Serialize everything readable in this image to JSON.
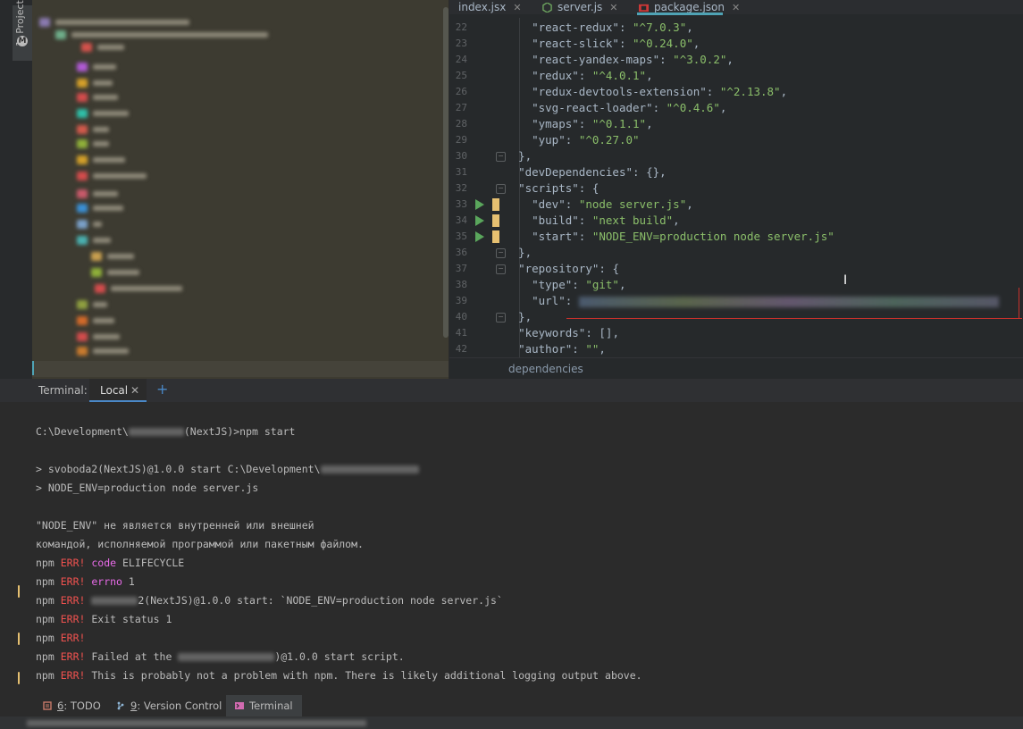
{
  "sidebar": {
    "project_tab_label": "1: Project",
    "project_tab_icon": "M"
  },
  "editor": {
    "tabs": [
      {
        "label": "index.jsx",
        "icon": "react-file-icon"
      },
      {
        "label": "server.js",
        "icon": "nodejs-file-icon"
      },
      {
        "label": "package.json",
        "icon": "npm-file-icon",
        "active": true
      }
    ],
    "lines": [
      {
        "no": "22",
        "key": "\"react-redux\"",
        "val": "\"^7.0.3\"",
        "tail": ","
      },
      {
        "no": "23",
        "key": "\"react-slick\"",
        "val": "\"^0.24.0\"",
        "tail": ","
      },
      {
        "no": "24",
        "key": "\"react-yandex-maps\"",
        "val": "\"^3.0.2\"",
        "tail": ","
      },
      {
        "no": "25",
        "key": "\"redux\"",
        "val": "\"^4.0.1\"",
        "tail": ","
      },
      {
        "no": "26",
        "key": "\"redux-devtools-extension\"",
        "val": "\"^2.13.8\"",
        "tail": ","
      },
      {
        "no": "27",
        "key": "\"svg-react-loader\"",
        "val": "\"^0.4.6\"",
        "tail": ","
      },
      {
        "no": "28",
        "key": "\"ymaps\"",
        "val": "\"^0.1.1\"",
        "tail": ","
      },
      {
        "no": "29",
        "key": "\"yup\"",
        "val": "\"^0.27.0\"",
        "tail": ""
      },
      {
        "no": "30",
        "text": "},"
      },
      {
        "no": "31",
        "key": "\"devDependencies\"",
        "val": "",
        "tail": "{},"
      },
      {
        "no": "32",
        "key": "\"scripts\"",
        "val": "",
        "tail": "{"
      },
      {
        "no": "33",
        "key": "\"dev\"",
        "val": "\"node server.js\"",
        "tail": ","
      },
      {
        "no": "34",
        "key": "\"build\"",
        "val": "\"next build\"",
        "tail": ","
      },
      {
        "no": "35",
        "key": "\"start\"",
        "val": "\"NODE_ENV=production node server.js\"",
        "tail": ""
      },
      {
        "no": "36",
        "text": "},"
      },
      {
        "no": "37",
        "key": "\"repository\"",
        "val": "",
        "tail": "{"
      },
      {
        "no": "38",
        "key": "\"type\"",
        "val": "\"git\"",
        "tail": ","
      },
      {
        "no": "39",
        "key": "\"url\"",
        "val": "",
        "tail": ""
      },
      {
        "no": "40",
        "text": "},"
      },
      {
        "no": "41",
        "key": "\"keywords\"",
        "val": "",
        "tail": "[],"
      },
      {
        "no": "42",
        "key": "\"author\"",
        "val": "\"\"",
        "tail": ","
      }
    ],
    "breadcrumb": "dependencies"
  },
  "terminal": {
    "title": "Terminal:",
    "tab_label": "Local",
    "tab_close": "✕",
    "add_label": "+",
    "lines": {
      "prompt_a": "C:\\Development\\",
      "prompt_b": "(NextJS)>npm start",
      "start_a": "> svoboda2(NextJS)@1.0.0 start C:\\Development\\",
      "env_cmd": "> NODE_ENV=production node server.js",
      "win_err_1": "\"NODE_ENV\" не является внутренней или внешней",
      "win_err_2": "командой, исполняемой программой или пакетным файлом.",
      "npm": "npm",
      "err": "ERR!",
      "code_kw": "code",
      "code_val": "ELIFECYCLE",
      "errno_kw": "errno",
      "errno_val": "1",
      "script_line": "2(NextJS)@1.0.0 start: `NODE_ENV=production node server.js`",
      "exit_status": "Exit status 1",
      "failed_a": "Failed at the",
      "failed_b": ")@1.0.0 start script.",
      "not_problem": "This is probably not a problem with npm. There is likely additional logging output above."
    }
  },
  "bottom_tabs": {
    "todo_num": "6",
    "todo_label": ": TODO",
    "vc_num": "9",
    "vc_label": ": Version Control",
    "terminal_label": "Terminal"
  }
}
